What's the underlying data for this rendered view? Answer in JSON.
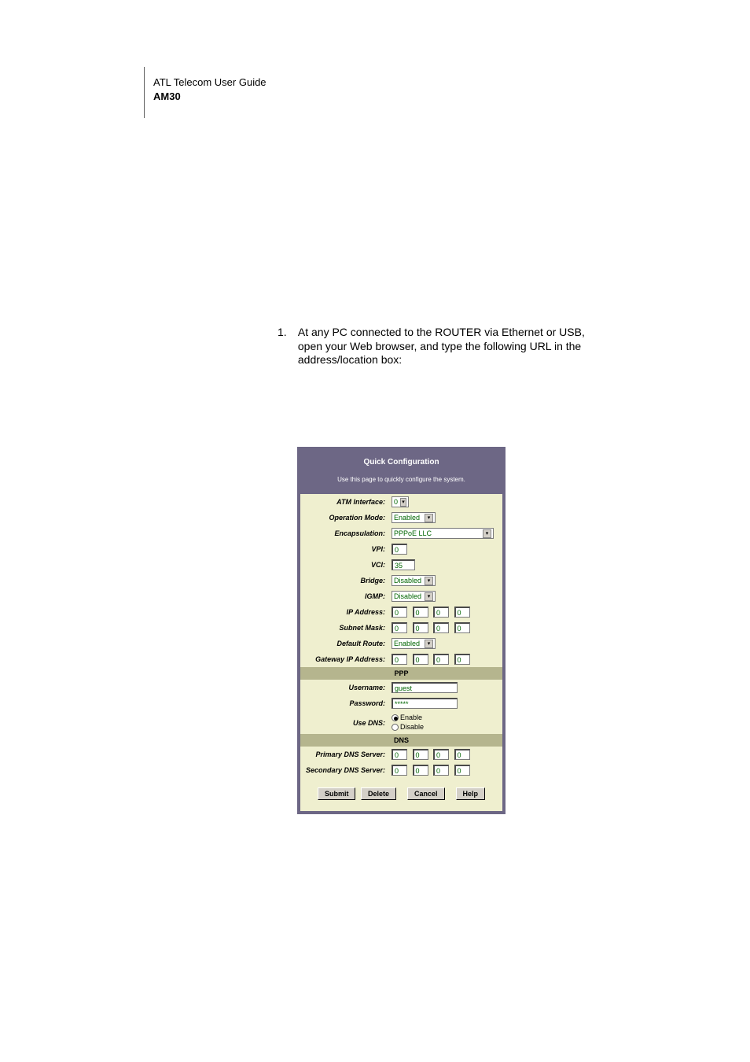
{
  "header": {
    "line1": "ATL Telecom User Guide",
    "line2": "AM30"
  },
  "instruction": {
    "number": "1.",
    "text": "At any PC connected to the ROUTER via Ethernet or USB, open your Web browser, and type the following URL in the address/location box:"
  },
  "panel": {
    "title": "Quick Configuration",
    "subtitle": "Use this page to quickly configure the system.",
    "rows": {
      "atm_interface": {
        "label": "ATM Interface:",
        "value": "0"
      },
      "operation_mode": {
        "label": "Operation Mode:",
        "value": "Enabled"
      },
      "encapsulation": {
        "label": "Encapsulation:",
        "value": "PPPoE LLC"
      },
      "vpi": {
        "label": "VPI:",
        "value": "0"
      },
      "vci": {
        "label": "VCI:",
        "value": "35"
      },
      "bridge": {
        "label": "Bridge:",
        "value": "Disabled"
      },
      "igmp": {
        "label": "IGMP:",
        "value": "Disabled"
      },
      "ip_address": {
        "label": "IP Address:",
        "o1": "0",
        "o2": "0",
        "o3": "0",
        "o4": "0"
      },
      "subnet_mask": {
        "label": "Subnet Mask:",
        "o1": "0",
        "o2": "0",
        "o3": "0",
        "o4": "0"
      },
      "default_route": {
        "label": "Default Route:",
        "value": "Enabled"
      },
      "gateway_ip": {
        "label": "Gateway IP Address:",
        "o1": "0",
        "o2": "0",
        "o3": "0",
        "o4": "0"
      }
    },
    "ppp_header": "PPP",
    "ppp": {
      "username": {
        "label": "Username:",
        "value": "guest"
      },
      "password": {
        "label": "Password:",
        "value": "*****"
      },
      "use_dns": {
        "label": "Use DNS:",
        "enable": "Enable",
        "disable": "Disable"
      }
    },
    "dns_header": "DNS",
    "dns": {
      "primary": {
        "label": "Primary DNS Server:",
        "o1": "0",
        "o2": "0",
        "o3": "0",
        "o4": "0"
      },
      "secondary": {
        "label": "Secondary DNS Server:",
        "o1": "0",
        "o2": "0",
        "o3": "0",
        "o4": "0"
      }
    },
    "buttons": {
      "submit": "Submit",
      "delete": "Delete",
      "cancel": "Cancel",
      "help": "Help"
    }
  }
}
